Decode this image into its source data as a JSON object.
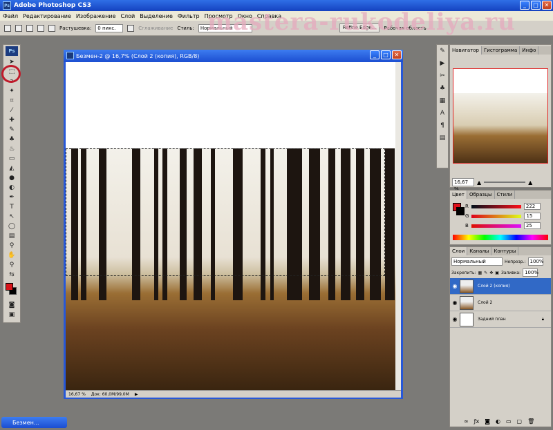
{
  "app": {
    "title": "Adobe Photoshop CS3",
    "logo": "Ps"
  },
  "watermark": "mastera-rukodeliya.ru",
  "menu": [
    "Файл",
    "Редактирование",
    "Изображение",
    "Слой",
    "Выделение",
    "Фильтр",
    "Просмотр",
    "Окно",
    "Справка"
  ],
  "options": {
    "feather_label": "Растушевка:",
    "feather_value": "0 пикс.",
    "antialias_label": "Сглаживание",
    "style_label": "Стиль:",
    "style_value": "Нормальный",
    "refine_edge": "Refine Edge...",
    "workspace": "Рабочая область"
  },
  "document": {
    "title": "Безмен-2 @ 16,7% (Слой 2 (копия), RGB/8)",
    "zoom": "16,67 %",
    "doc_info": "Док: 60,0M/99,0M"
  },
  "navigator": {
    "tabs": [
      "Навигатор",
      "Гистограмма",
      "Инфо"
    ],
    "zoom": "16,67 %"
  },
  "color_panel": {
    "tabs": [
      "Цвет",
      "Образцы",
      "Стили"
    ],
    "r_label": "R",
    "r": "222",
    "g_label": "G",
    "g": "15",
    "b_label": "B",
    "b": "25",
    "fg": "#de0f19"
  },
  "layers_panel": {
    "tabs": [
      "Слои",
      "Каналы",
      "Контуры"
    ],
    "blend": "Нормальный",
    "opacity_label": "Непрозр.:",
    "opacity": "100%",
    "lock_label": "Закрепить:",
    "fill_label": "Заливка:",
    "fill": "100%",
    "layers": [
      {
        "name": "Слой 2 (копия)",
        "selected": true
      },
      {
        "name": "Слой 2",
        "selected": false
      },
      {
        "name": "Задний план",
        "selected": false
      }
    ]
  },
  "taskbar": {
    "title": "Безмен..."
  }
}
